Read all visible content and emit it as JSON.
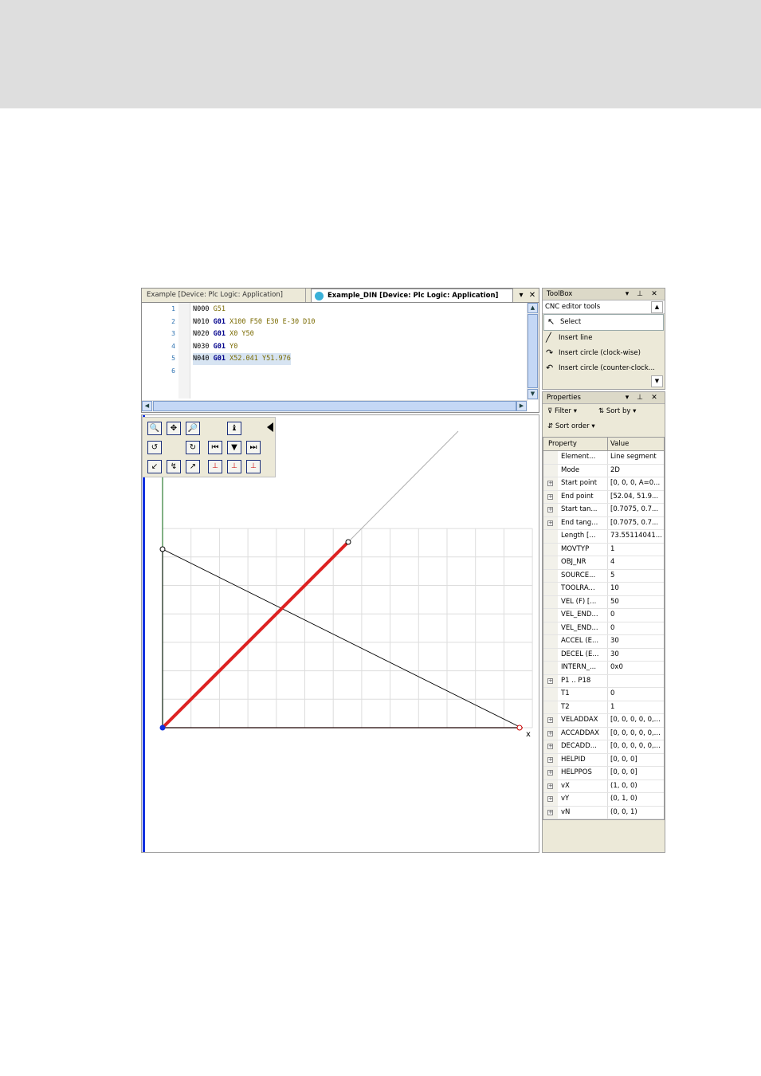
{
  "editor": {
    "tabs": [
      {
        "label": "Example [Device: Plc Logic: Application]",
        "active": false
      },
      {
        "label": "Example_DIN [Device: Plc Logic: Application]",
        "active": true
      }
    ],
    "lines": [
      {
        "num": "1",
        "tokens": [
          {
            "t": "N000 ",
            "c": ""
          },
          {
            "t": "G51",
            "c": "w"
          }
        ]
      },
      {
        "num": "2",
        "tokens": [
          {
            "t": "N010 ",
            "c": ""
          },
          {
            "t": "G01",
            "c": "g"
          },
          {
            "t": " X100 F50 E30 E-30 D10",
            "c": "w"
          }
        ]
      },
      {
        "num": "3",
        "tokens": [
          {
            "t": "N020 ",
            "c": ""
          },
          {
            "t": "G01",
            "c": "g"
          },
          {
            "t": " X0 Y50",
            "c": "w"
          }
        ]
      },
      {
        "num": "4",
        "tokens": [
          {
            "t": "N030 ",
            "c": ""
          },
          {
            "t": "G01",
            "c": "g"
          },
          {
            "t": " Y0",
            "c": "w"
          }
        ]
      },
      {
        "num": "5",
        "tokens": [
          {
            "t": "N040 ",
            "c": ""
          },
          {
            "t": "G01",
            "c": "g"
          },
          {
            "t": " X52.041 Y51.976",
            "c": "w"
          }
        ],
        "selected": true
      },
      {
        "num": "6",
        "tokens": []
      }
    ]
  },
  "canvas": {
    "x_axis_label": "x",
    "colors": {
      "path": "#000000",
      "selected_segment": "#dd2222",
      "x_axis": "#8b0000",
      "y_axis": "#2e7d32",
      "grid": "#dddddd",
      "cursor": "#1030e0"
    }
  },
  "view_tools": [
    {
      "icon": "zoom-in-icon",
      "glyph": "🔍"
    },
    {
      "icon": "pan-icon",
      "glyph": "✥"
    },
    {
      "icon": "zoom-out-icon",
      "glyph": "🔎"
    },
    {
      "icon": "pen-up-icon",
      "glyph": "♝"
    },
    {
      "icon": "rotate-left-icon",
      "glyph": "↺"
    },
    {
      "icon": "rotate-right-icon",
      "glyph": "↻"
    },
    {
      "icon": "skip-back-icon",
      "glyph": "⏮"
    },
    {
      "icon": "step-down-icon",
      "glyph": "▼"
    },
    {
      "icon": "skip-forward-icon",
      "glyph": "⏭"
    },
    {
      "icon": "curve-1-icon",
      "glyph": "↙"
    },
    {
      "icon": "curve-2-icon",
      "glyph": "↯"
    },
    {
      "icon": "curve-3-icon",
      "glyph": "↗"
    },
    {
      "icon": "axis-xy-icon",
      "glyph": "⊥"
    },
    {
      "icon": "axis-xz-icon",
      "glyph": "⊥"
    },
    {
      "icon": "axis-yz-icon",
      "glyph": "⊥"
    }
  ],
  "toolbox": {
    "title": "ToolBox",
    "section": "CNC editor tools",
    "items": [
      {
        "label": "Select",
        "icon": "pointer-icon",
        "glyph": "↖",
        "selected": true
      },
      {
        "label": "Insert line",
        "icon": "line-icon",
        "glyph": "╱",
        "selected": false
      },
      {
        "label": "Insert circle (clock-wise)",
        "icon": "circle-cw-icon",
        "glyph": "↷",
        "selected": false
      },
      {
        "label": "Insert circle (counter-clock...",
        "icon": "circle-ccw-icon",
        "glyph": "↶",
        "selected": false
      }
    ]
  },
  "properties": {
    "title": "Properties",
    "filter_label": "Filter",
    "sort_by_label": "Sort by",
    "sort_order_label": "Sort order",
    "col_property": "Property",
    "col_value": "Value",
    "rows": [
      {
        "name": "Element...",
        "value": "Line segment",
        "expandable": false
      },
      {
        "name": "Mode",
        "value": "2D",
        "expandable": false
      },
      {
        "name": "Start point",
        "value": "[0, 0, 0, A=0...",
        "expandable": true
      },
      {
        "name": "End point",
        "value": "[52.04, 51.9...",
        "expandable": true
      },
      {
        "name": "Start tan...",
        "value": "[0.7075, 0.7...",
        "expandable": true
      },
      {
        "name": "End tang...",
        "value": "[0.7075, 0.7...",
        "expandable": true
      },
      {
        "name": "Length [...",
        "value": "73.55114041...",
        "expandable": false
      },
      {
        "name": "MOVTYP",
        "value": "1",
        "expandable": false
      },
      {
        "name": "OBJ_NR",
        "value": "4",
        "expandable": false
      },
      {
        "name": "SOURCE...",
        "value": "5",
        "expandable": false
      },
      {
        "name": "TOOLRA...",
        "value": "10",
        "expandable": false
      },
      {
        "name": "VEL (F) [...",
        "value": "50",
        "expandable": false
      },
      {
        "name": "VEL_END...",
        "value": "0",
        "expandable": false
      },
      {
        "name": "VEL_END...",
        "value": "0",
        "expandable": false
      },
      {
        "name": "ACCEL (E...",
        "value": "30",
        "expandable": false
      },
      {
        "name": "DECEL (E...",
        "value": "30",
        "expandable": false
      },
      {
        "name": "INTERN_...",
        "value": "0x0",
        "expandable": false
      },
      {
        "name": "P1 .. P18",
        "value": "",
        "expandable": true
      },
      {
        "name": "T1",
        "value": "0",
        "expandable": false
      },
      {
        "name": "T2",
        "value": "1",
        "expandable": false
      },
      {
        "name": "VELADDAX",
        "value": "[0, 0, 0, 0, 0,...",
        "expandable": true
      },
      {
        "name": "ACCADDAX",
        "value": "[0, 0, 0, 0, 0,...",
        "expandable": true
      },
      {
        "name": "DECADD...",
        "value": "[0, 0, 0, 0, 0,...",
        "expandable": true
      },
      {
        "name": "HELPID",
        "value": "[0, 0, 0]",
        "expandable": true
      },
      {
        "name": "HELPPOS",
        "value": "[0, 0, 0]",
        "expandable": true
      },
      {
        "name": "vX",
        "value": "(1, 0, 0)",
        "expandable": true
      },
      {
        "name": "vY",
        "value": "(0, 1, 0)",
        "expandable": true
      },
      {
        "name": "vN",
        "value": "(0, 0, 1)",
        "expandable": true
      }
    ]
  }
}
